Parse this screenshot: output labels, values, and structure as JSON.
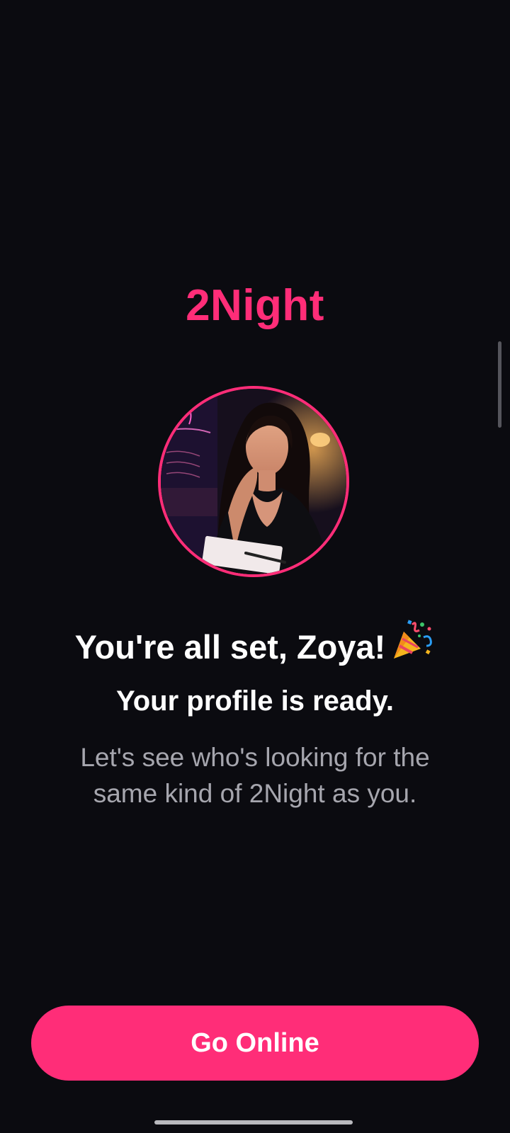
{
  "theme": {
    "accent": "#ff2d78",
    "background": "#0b0b10",
    "text_secondary": "#a6a6ae"
  },
  "header": {
    "app_name": "2Night"
  },
  "profile": {
    "avatar_icon": "profile-photo"
  },
  "message": {
    "headline": "You're all set, Zoya!",
    "headline_icon": "party-popper-icon",
    "subhead": "Your profile is ready.",
    "description": "Let's see who's looking for the same kind of 2Night as you."
  },
  "actions": {
    "go_online_label": "Go Online"
  }
}
